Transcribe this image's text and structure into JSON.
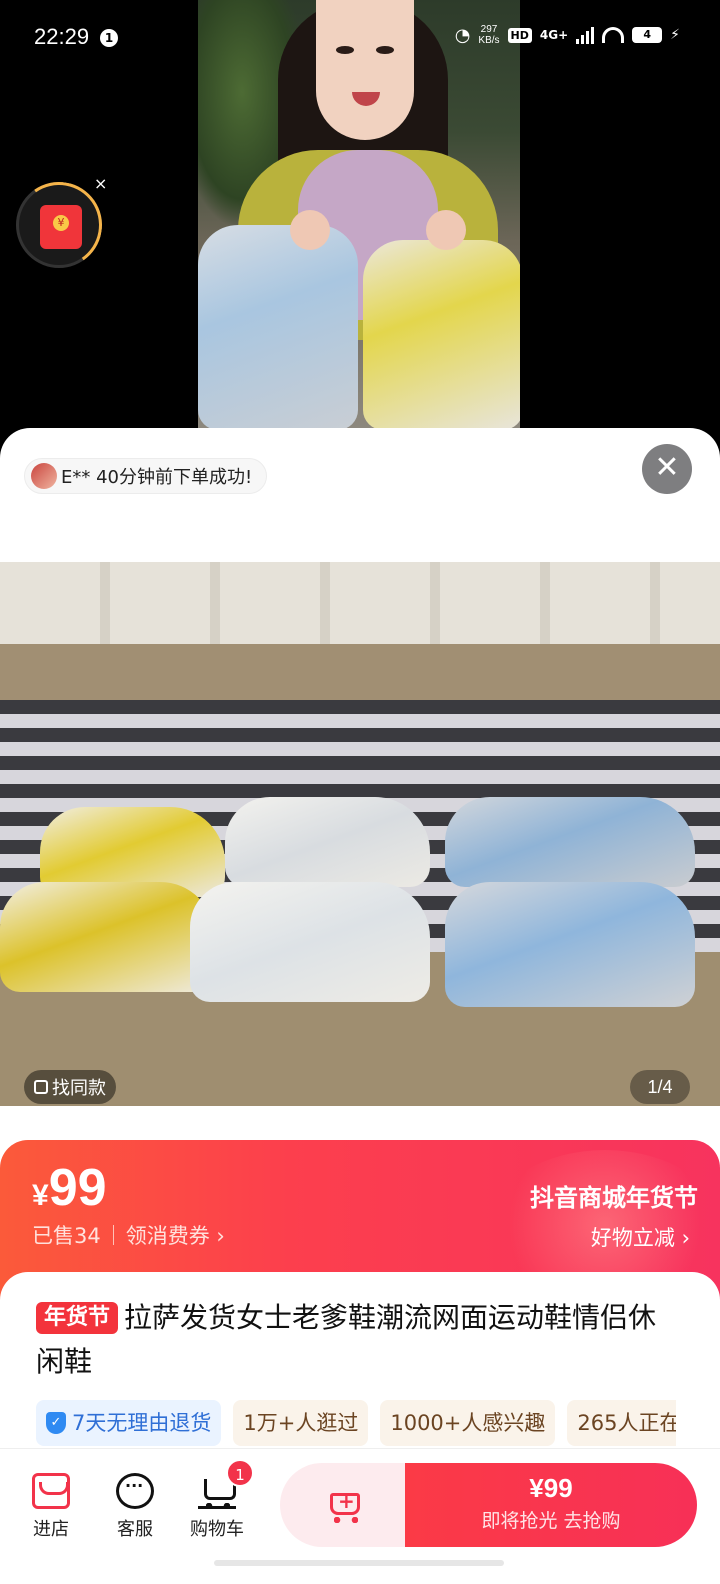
{
  "status_bar": {
    "time": "22:29",
    "notification_badge": "1",
    "net_speed_value": "297",
    "net_speed_unit": "KB/s",
    "hd_label": "HD",
    "network_label": "4G+",
    "battery_level": "4"
  },
  "video": {
    "red_packet_close": "×"
  },
  "order_notice": {
    "text": "E** 40分钟前下单成功!"
  },
  "sheet": {
    "close_icon": "✕"
  },
  "product_image": {
    "find_similar_label": "找同款",
    "page_indicator": "1/4"
  },
  "price_banner": {
    "currency": "¥",
    "price": "99",
    "sold_text": "已售34",
    "coupon_text": "领消费券 ›",
    "festival_title": "抖音商城年货节",
    "festival_sub": "好物立减 ›"
  },
  "product": {
    "festival_tag": "年货节",
    "title": "拉萨发货女士老爹鞋潮流网面运动鞋情侣休闲鞋",
    "chips": [
      "7天无理由退货",
      "1万+人逛过",
      "1000+人感兴趣",
      "265人正在"
    ]
  },
  "bottom_bar": {
    "shop_label": "进店",
    "service_label": "客服",
    "cart_label": "购物车",
    "cart_badge": "1",
    "buy_price": "¥99",
    "buy_sub": "即将抢光  去抢购"
  },
  "colors": {
    "accent": "#f2334a",
    "banner_start": "#fb5a3a",
    "banner_end": "#f7335e"
  }
}
